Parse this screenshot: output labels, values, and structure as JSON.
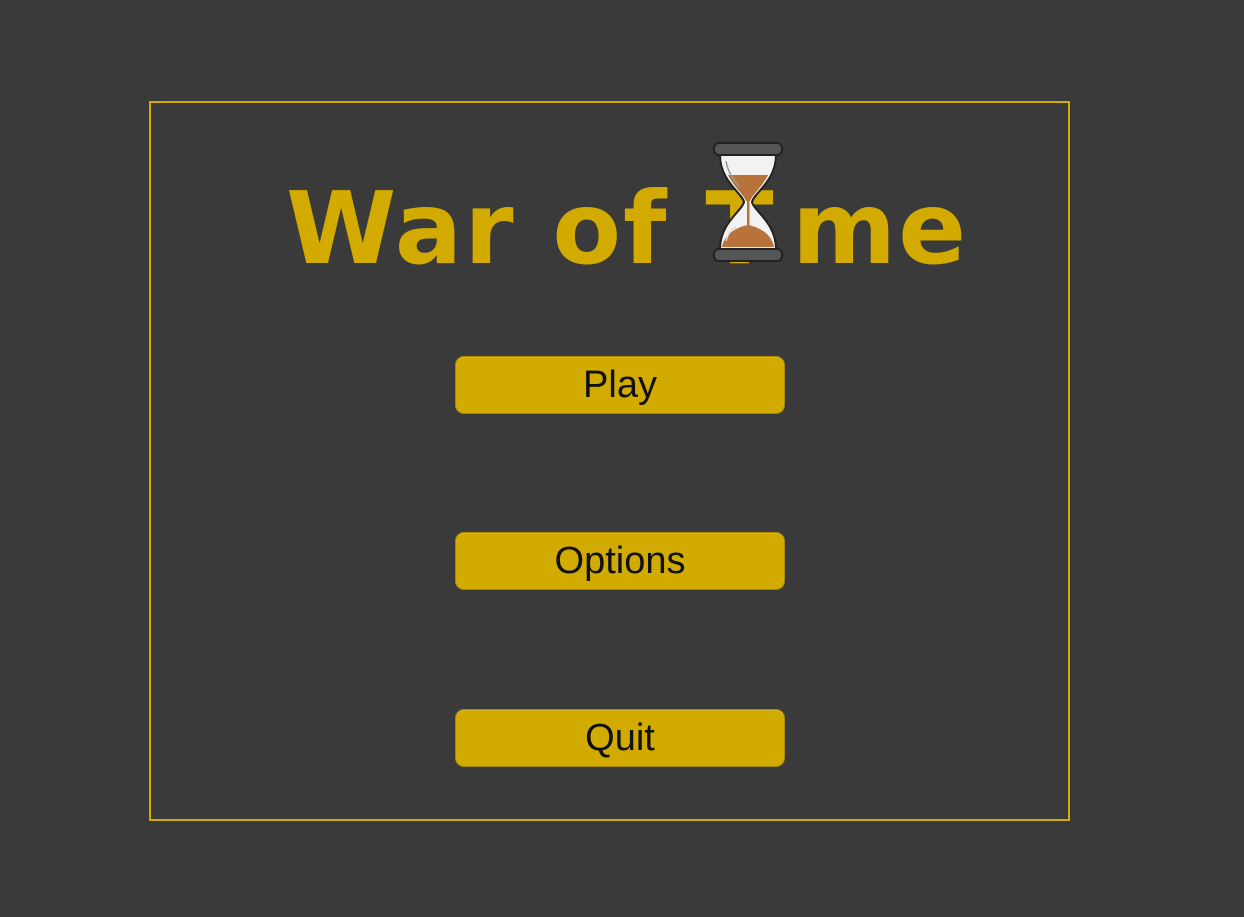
{
  "title": {
    "part1": "War of T",
    "part2": "me",
    "hourglass_icon": "hourglass-icon"
  },
  "menu": {
    "play_label": "Play",
    "options_label": "Options",
    "quit_label": "Quit"
  },
  "colors": {
    "background": "#3a3a3a",
    "accent": "#d2aa00",
    "button_text": "#111111"
  }
}
